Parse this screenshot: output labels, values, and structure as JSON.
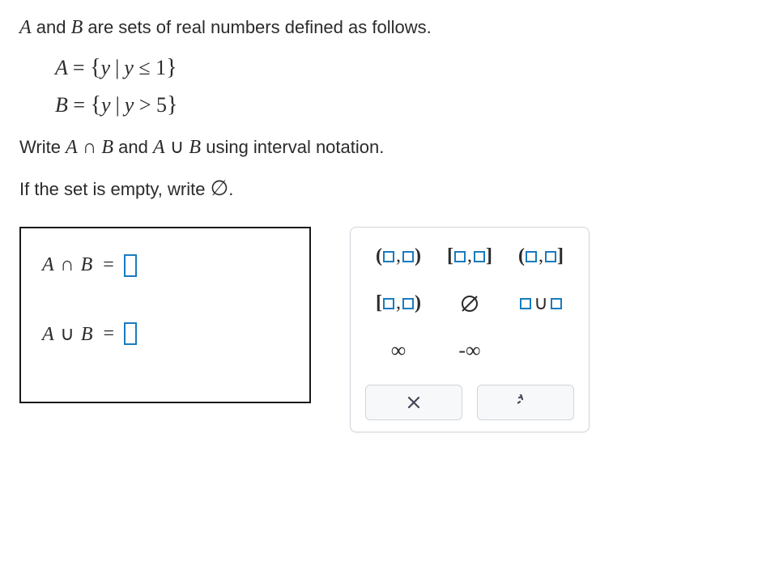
{
  "prompt": {
    "line1_pre": " and ",
    "line1_post": " are sets of real numbers defined as follows.",
    "set_A_name": "A",
    "set_A_var": "y",
    "set_A_rel": "≤",
    "set_A_val": "1",
    "set_B_name": "B",
    "set_B_var": "y",
    "set_B_rel": ">",
    "set_B_val": "5",
    "instruct_write_pre": "Write ",
    "instruct_write_mid": " and ",
    "instruct_write_post": " using interval notation.",
    "instruct_empty_pre": "If the set is empty, write ",
    "instruct_empty_post": "."
  },
  "answers": {
    "intersection_label": "A ∩ B",
    "union_label": "A ∪ B",
    "eq": "="
  },
  "keypad": {
    "open_open": {
      "left": "(",
      "right": ")"
    },
    "closed_closed": {
      "left": "[",
      "right": "]"
    },
    "open_closed": {
      "left": "(",
      "right": "]"
    },
    "closed_open": {
      "left": "[",
      "right": ")"
    },
    "empty_set": "∅",
    "union_sym": "∪",
    "infinity": "∞",
    "neg_infinity": "-∞"
  }
}
